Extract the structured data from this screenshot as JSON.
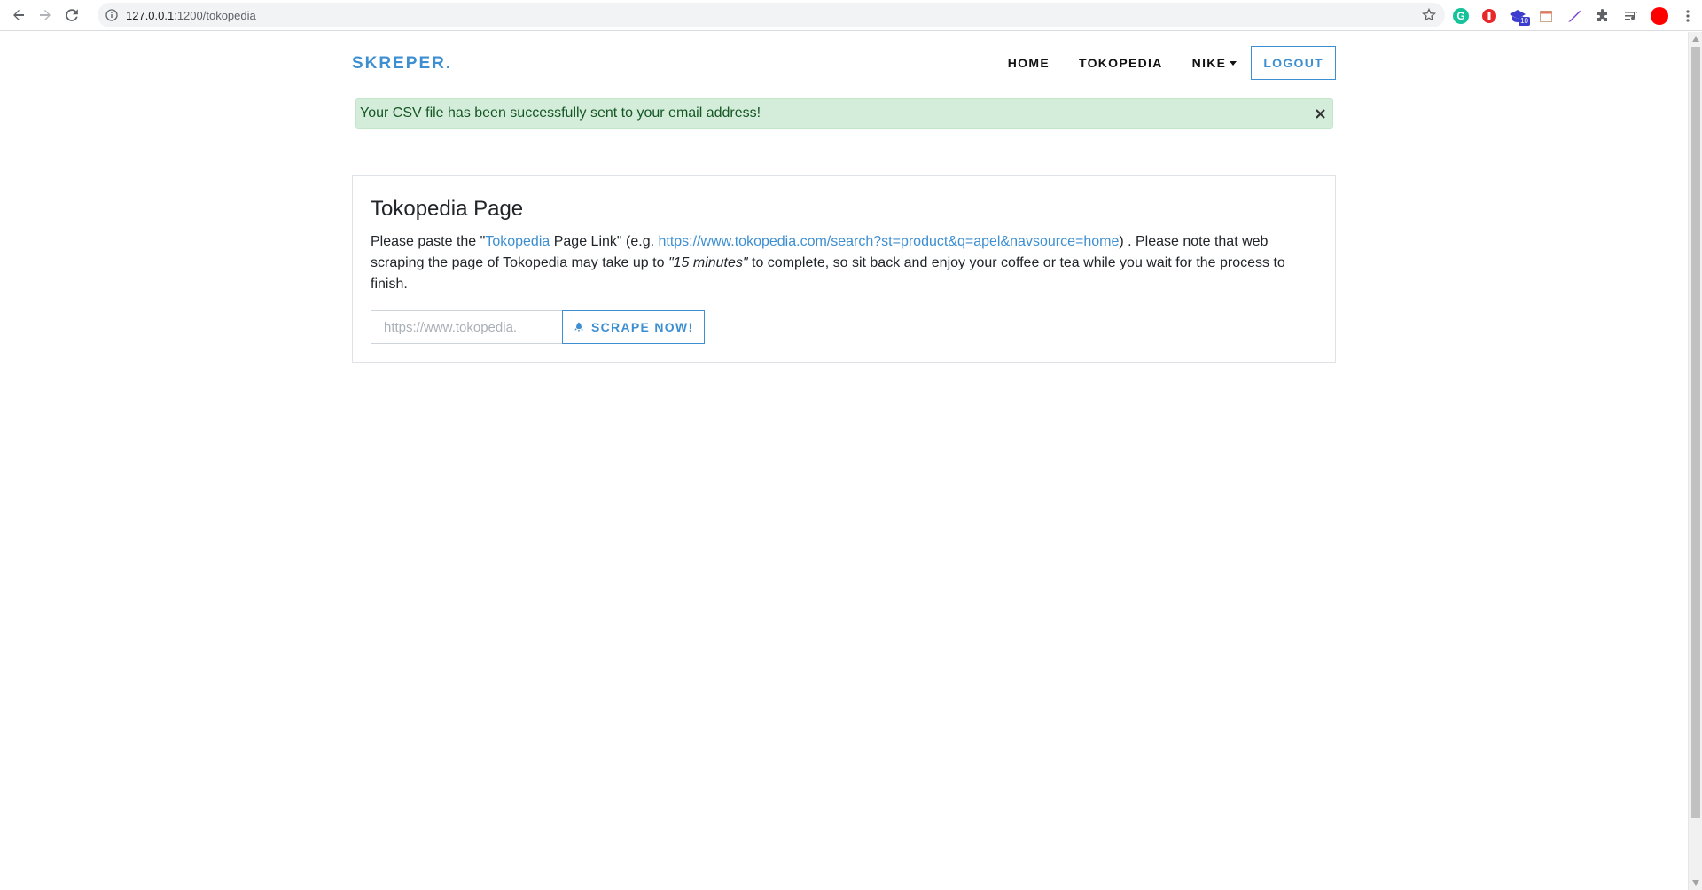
{
  "browser": {
    "url_host": "127.0.0.1",
    "url_path": ":1200/tokopedia",
    "extensions": [
      {
        "name": "grammarly-icon",
        "color": "#15c39a"
      },
      {
        "name": "adblock-icon",
        "color": "#e8272a"
      },
      {
        "name": "graduation-cap-icon",
        "color": "#3c3ccf",
        "badge": "10"
      },
      {
        "name": "calendar-icon",
        "color": "#e0c8b0"
      },
      {
        "name": "feather-icon",
        "color": "#7b3fd1"
      },
      {
        "name": "puzzle-icon",
        "color": "#5f6368"
      },
      {
        "name": "queue-icon",
        "color": "#5f6368"
      },
      {
        "name": "profile-avatar",
        "color": "#ff0000"
      },
      {
        "name": "menu-icon",
        "color": "#5f6368"
      }
    ]
  },
  "navbar": {
    "brand": "SKREPER.",
    "links": {
      "home": "HOME",
      "tokopedia": "TOKOPEDIA",
      "nike": "NIKE"
    },
    "logout": "LOGOUT"
  },
  "alert": {
    "message": "Your CSV file has been successfully sent to your email address!"
  },
  "card": {
    "title": "Tokopedia Page",
    "desc": {
      "part1": "Please paste the \"",
      "link1": "Tokopedia",
      "part2": " Page Link\" (e.g. ",
      "link2": "https://www.tokopedia.com/search?st=product&q=apel&navsource=home",
      "part3": ") . Please note that web scraping the page of Tokopedia may take up to ",
      "emphasis": "\"15 minutes\"",
      "part4": " to complete, so sit back and enjoy your coffee or tea while you wait for the process to finish."
    },
    "input": {
      "value": "",
      "placeholder": "https://www.tokopedia."
    },
    "button": "SCRAPE NOW!"
  },
  "colors": {
    "brand": "#3d8fd1",
    "alert_bg": "#d4edda",
    "alert_text": "#155724"
  }
}
